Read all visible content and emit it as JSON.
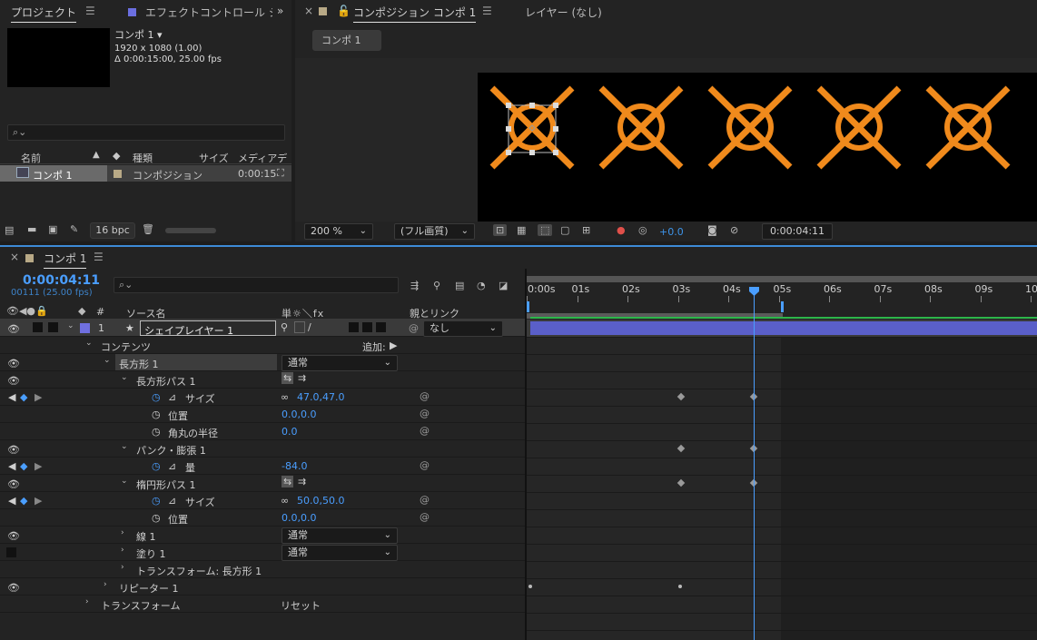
{
  "project_panel": {
    "tab_label": "プロジェクト",
    "effects_tab_label": "エフェクトコントロール シ",
    "comp_name": "コンポ 1",
    "comp_info_size": "1920 x 1080 (1.00)",
    "comp_info_duration": "Δ 0:00:15:00, 25.00 fps",
    "search_placeholder": "",
    "columns": {
      "name": "名前",
      "type": "種類",
      "size": "サイズ",
      "media": "メディアデ"
    },
    "items": [
      {
        "name": "コンポ 1",
        "type": "コンポジション",
        "duration": "0:00:15"
      }
    ],
    "bpc": "16 bpc"
  },
  "composition_panel": {
    "tab_label": "コンポジション コンポ 1",
    "layer_label": "レイヤー (なし)",
    "subtab": "コンポ 1",
    "zoom": "200 %",
    "quality": "(フル画質)",
    "exposure": "+0.0",
    "timecode": "0:00:04:11",
    "accent_orange": "#f08a1c"
  },
  "timeline": {
    "tab_label": "コンポ 1",
    "current_time": "0:00:04:11",
    "frame_info": "00111 (25.00 fps)",
    "col_hash": "#",
    "col_source": "ソース名",
    "col_switches": "単☼＼fx",
    "col_parent": "親とリンク",
    "ruler_labels": [
      "0:00s",
      "01s",
      "02s",
      "03s",
      "04s",
      "05s",
      "06s",
      "07s",
      "08s",
      "09s",
      "10"
    ],
    "layer": {
      "number": "1",
      "name": "シェイプレイヤー 1",
      "parent": "なし"
    },
    "rows": {
      "contents": "コンテンツ",
      "add": "追加:",
      "rect1": "長方形 1",
      "rect1_blend": "通常",
      "rect_path": "長方形パス 1",
      "size": "サイズ",
      "size_val": "47.0,47.0",
      "position": "位置",
      "position_val": "0.0,0.0",
      "roundness": "角丸の半径",
      "roundness_val": "0.0",
      "pucker": "パンク・膨張 1",
      "amount": "量",
      "amount_val": "-84.0",
      "ellipse_path": "楕円形パス 1",
      "ellipse_size": "サイズ",
      "ellipse_size_val": "50.0,50.0",
      "ellipse_pos": "位置",
      "ellipse_pos_val": "0.0,0.0",
      "stroke": "線 1",
      "stroke_blend": "通常",
      "fill": "塗り 1",
      "fill_blend": "通常",
      "transform_rect": "トランスフォーム: 長方形 1",
      "repeater": "リピーター 1",
      "transform": "トランスフォーム",
      "reset": "リセット"
    }
  }
}
